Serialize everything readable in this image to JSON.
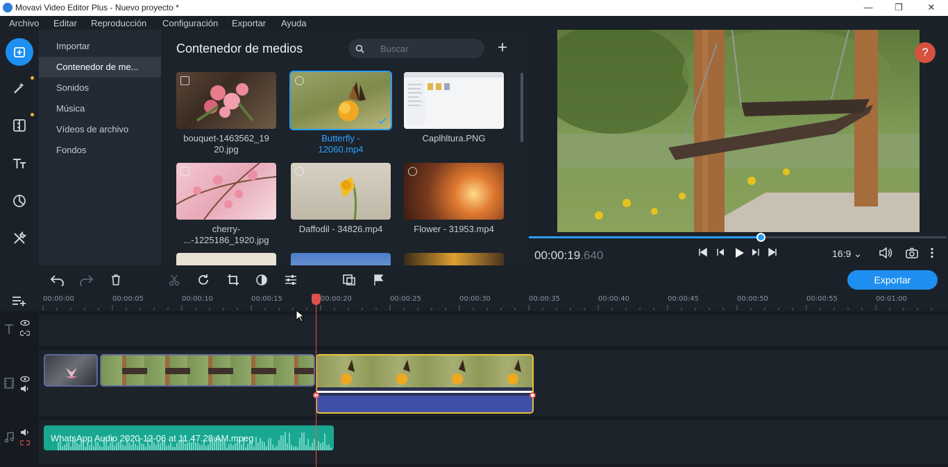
{
  "window": {
    "title": "Movavi Video Editor Plus - Nuevo proyecto *",
    "minimize": "—",
    "maximize": "❐",
    "close": "✕"
  },
  "menu": [
    "Archivo",
    "Editar",
    "Reproducción",
    "Configuración",
    "Exportar",
    "Ayuda"
  ],
  "rail_icons": [
    "import-icon",
    "magic-wand-icon",
    "transitions-icon",
    "titles-icon",
    "stickers-icon",
    "tools-icon"
  ],
  "subnav": {
    "items": [
      "Importar",
      "Contenedor de me...",
      "Sonidos",
      "Música",
      "Vídeos de archivo",
      "Fondos"
    ],
    "active_index": 1
  },
  "media": {
    "title": "Contenedor de medios",
    "search_placeholder": "Buscar",
    "add": "+",
    "items": [
      {
        "label": "bouquet-1463562_19\n20.jpg",
        "kind": "image"
      },
      {
        "label": "Butterfly -\n12060.mp4",
        "kind": "video",
        "selected": true
      },
      {
        "label": "Caplhltura.PNG",
        "kind": "image"
      },
      {
        "label": "cherry-\n...-1225186_1920.jpg",
        "kind": "image"
      },
      {
        "label": "Daffodil - 34826.mp4",
        "kind": "video"
      },
      {
        "label": "Flower - 31953.mp4",
        "kind": "video"
      }
    ]
  },
  "preview": {
    "help": "?",
    "timecode_main": "00:00:19",
    "timecode_frac": ".640",
    "progress_fraction": 0.555,
    "aspect": "16:9 ⌄"
  },
  "toolbar": {
    "export_label": "Exportar"
  },
  "ruler": [
    "00:00:00",
    "00:00:05",
    "00:00:10",
    "00:00:15",
    "00:00:20",
    "00:00:25",
    "00:00:30",
    "00:00:35",
    "00:00:40",
    "00:00:45",
    "00:00:50",
    "00:00:55",
    "00:01:00"
  ],
  "audio": {
    "clip_label": "WhatsApp Audio 2020-12-06 at 11.47.28 AM.mpeg"
  },
  "colors": {
    "accent": "#1e8ff0",
    "audio_clip": "#1aa791",
    "selected_clip_border": "#e8c33a",
    "playhead": "#e05050"
  }
}
